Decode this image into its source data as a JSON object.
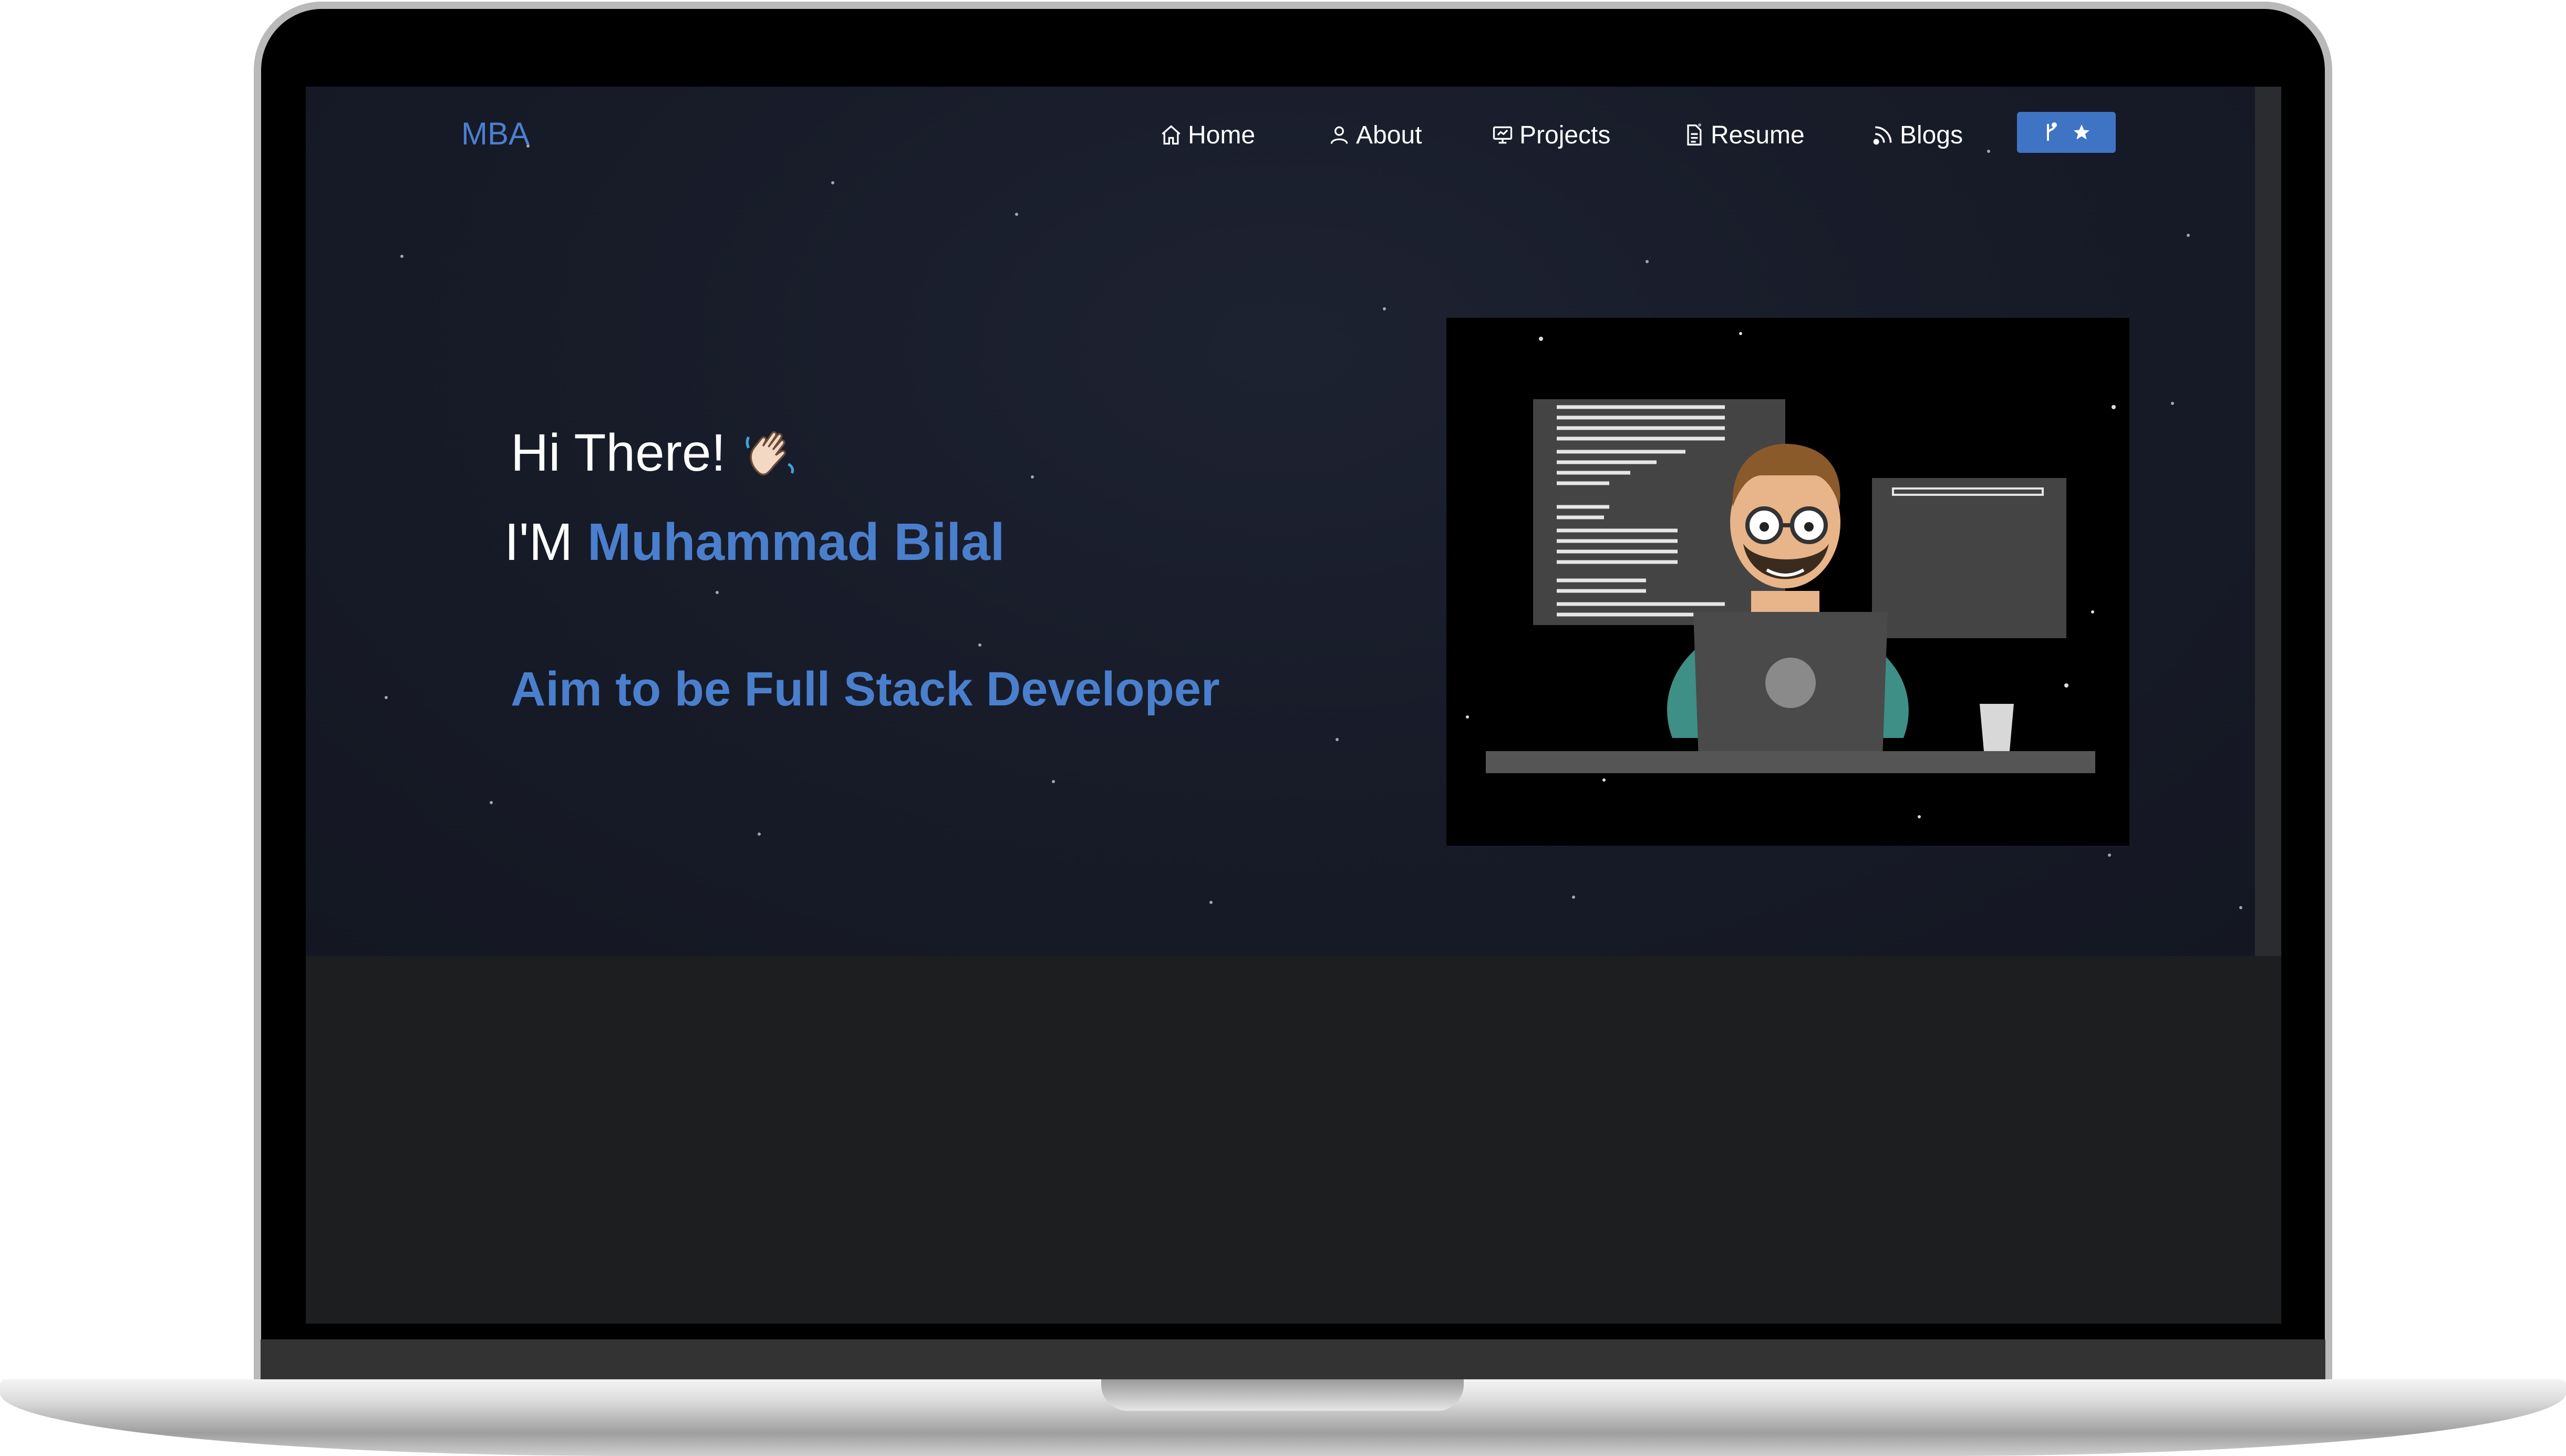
{
  "navbar": {
    "brand": "MBA",
    "items": [
      {
        "label": "Home",
        "icon": "home-icon"
      },
      {
        "label": "About",
        "icon": "user-icon"
      },
      {
        "label": "Projects",
        "icon": "projects-icon"
      },
      {
        "label": "Resume",
        "icon": "document-icon"
      },
      {
        "label": "Blogs",
        "icon": "feed-icon"
      }
    ],
    "fork_button": {
      "icons": [
        "git-fork-icon",
        "star-icon"
      ]
    }
  },
  "hero": {
    "greeting": "Hi There!",
    "greeting_emoji": "waving-hand-icon",
    "intro_prefix": "I'M",
    "name": "Muhammad Bilal",
    "tagline": "Aim to be Full Stack Developer",
    "illustration": "developer-at-laptop-illustration"
  },
  "colors": {
    "accent": "#4a7fcd",
    "button": "#3f74c5",
    "hero_bg": "#171b28",
    "lower_bg": "#1d1e20"
  }
}
